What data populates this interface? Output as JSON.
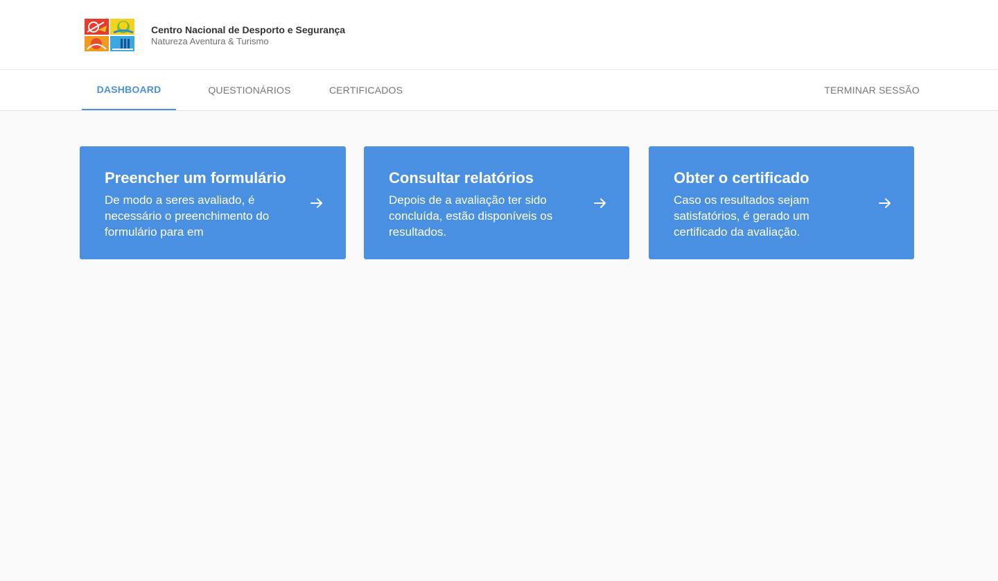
{
  "header": {
    "org_name": "Centro Nacional de Desporto e Segurança",
    "org_subtitle": "Natureza Aventura & Turismo",
    "logo_icon": "organization-logo"
  },
  "nav": {
    "tabs": [
      {
        "label": "DASHBOARD",
        "active": true
      },
      {
        "label": "QUESTIONÁRIOS",
        "active": false
      },
      {
        "label": "CERTIFICADOS",
        "active": false
      }
    ],
    "logout_label": "TERMINAR SESSÃO"
  },
  "cards": [
    {
      "title": "Preencher um formulário",
      "description": "De modo a seres avaliado, é necessário o preenchimento do formulário para em",
      "icon": "arrow-right-icon"
    },
    {
      "title": "Consultar relatórios",
      "description": "Depois de a avaliação ter sido concluída, estão disponíveis os resultados.",
      "icon": "arrow-right-icon"
    },
    {
      "title": "Obter o certificado",
      "description": "Caso os resultados sejam satisfatórios, é gerado um certificado da avaliação.",
      "icon": "arrow-right-icon"
    }
  ],
  "colors": {
    "accent": "#4a90e2",
    "background": "#f9f9f9",
    "nav_text": "#777777"
  }
}
